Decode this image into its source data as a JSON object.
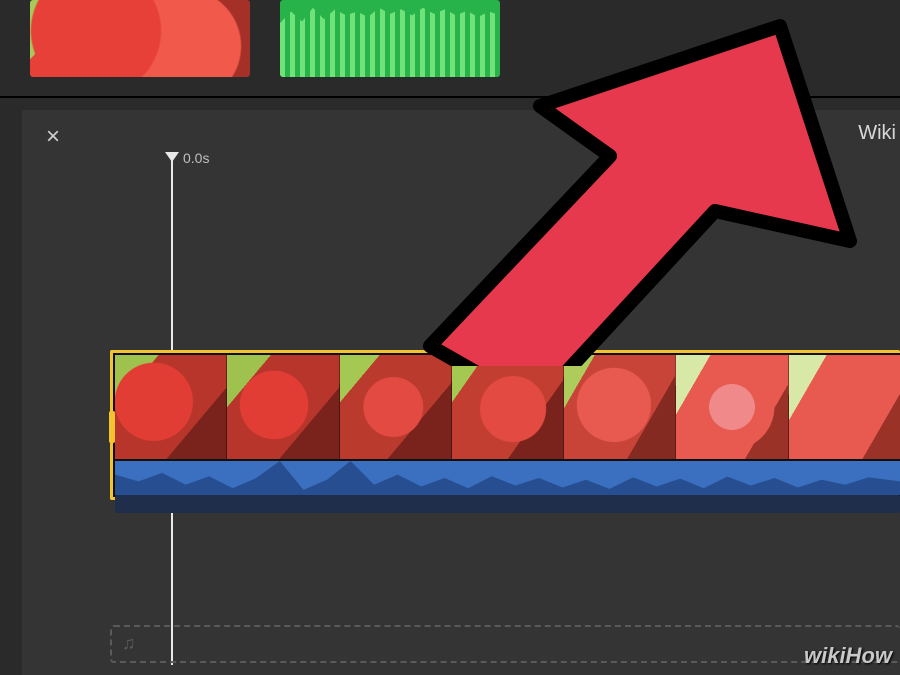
{
  "top_thumbs": [
    {
      "name": "strawberry-clip"
    },
    {
      "name": "green-waveform-clip"
    }
  ],
  "project": {
    "close_glyph": "×",
    "title_fragment": "Wiki"
  },
  "playhead": {
    "time_label": "0.0s"
  },
  "timeline": {
    "clip_selected": true,
    "frame_count": 7
  },
  "music_track": {
    "icon_glyph": "♫"
  },
  "watermark": "wikiHow",
  "arrow": {
    "fill": "#e6394d",
    "stroke": "#000000"
  }
}
